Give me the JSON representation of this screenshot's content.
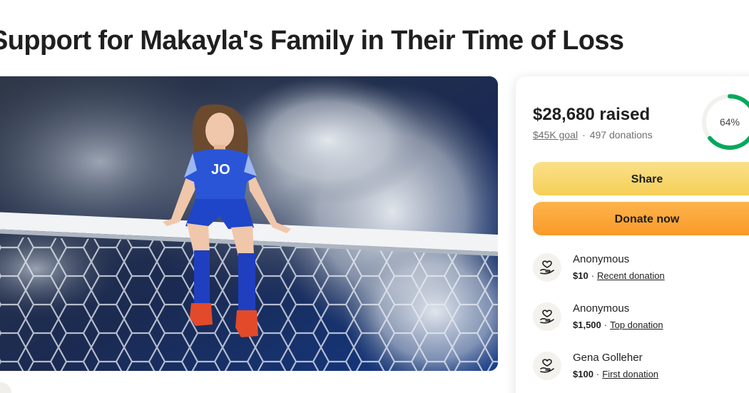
{
  "page": {
    "title": "Support for Makayla's Family in Their Time of Loss"
  },
  "hero": {
    "jersey_text": "JO"
  },
  "donation_card": {
    "raised": "$28,680 raised",
    "goal_link": "$45K goal",
    "separator": "·",
    "donation_count": "497 donations",
    "progress_label": "64%",
    "progress_value": 0.64,
    "share_label": "Share",
    "donate_label": "Donate now",
    "accent_green": "#02a95c",
    "donations": [
      {
        "name": "Anonymous",
        "amount": "$10",
        "tag": "Recent donation"
      },
      {
        "name": "Anonymous",
        "amount": "$1,500",
        "tag": "Top donation"
      },
      {
        "name": "Gena Golleher",
        "amount": "$100",
        "tag": "First donation"
      }
    ]
  }
}
